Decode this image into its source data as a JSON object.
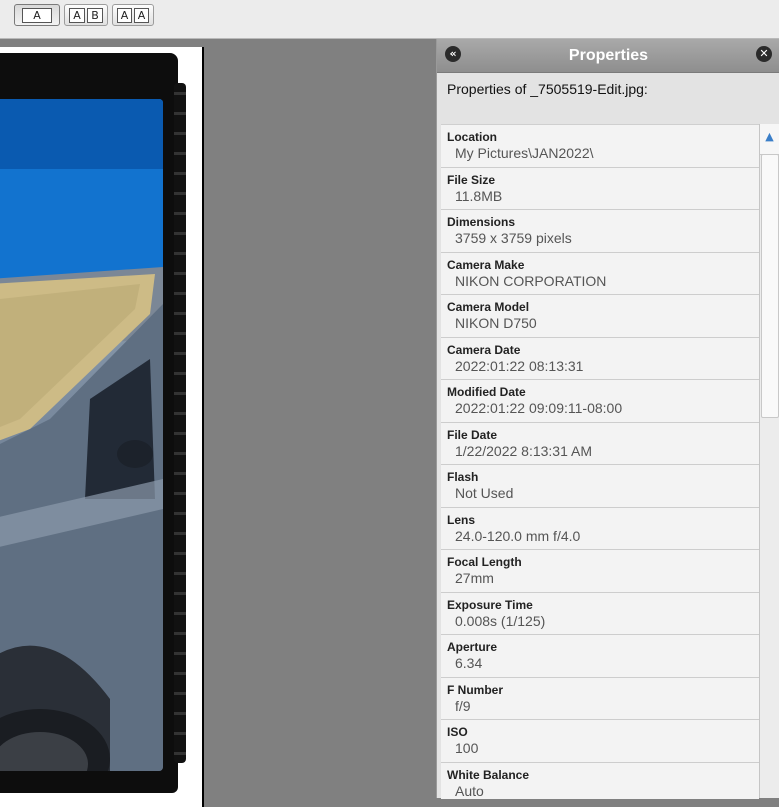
{
  "toolbar": {
    "buttons": [
      {
        "cells": [
          "A"
        ]
      },
      {
        "cells": [
          "A",
          "B"
        ]
      },
      {
        "cells": [
          "A",
          "A"
        ]
      }
    ]
  },
  "panel": {
    "title": "Properties",
    "collapse_icon": "double-chevron-left-icon",
    "close_icon": "close-icon",
    "subtitle": "Properties of _7505519-Edit.jpg:",
    "scroll_up_icon": "chevron-up-icon",
    "items": [
      {
        "label": "Location",
        "value": "My Pictures\\JAN2022\\"
      },
      {
        "label": "File Size",
        "value": "11.8MB"
      },
      {
        "label": "Dimensions",
        "value": "3759 x 3759 pixels"
      },
      {
        "label": "Camera Make",
        "value": "NIKON CORPORATION"
      },
      {
        "label": "Camera Model",
        "value": "NIKON D750"
      },
      {
        "label": "Camera Date",
        "value": "2022:01:22 08:13:31"
      },
      {
        "label": "Modified Date",
        "value": "2022:01:22 09:09:11-08:00"
      },
      {
        "label": "File Date",
        "value": "1/22/2022 8:13:31 AM"
      },
      {
        "label": "Flash",
        "value": "Not Used"
      },
      {
        "label": "Lens",
        "value": "24.0-120.0 mm f/4.0"
      },
      {
        "label": "Focal Length",
        "value": "27mm"
      },
      {
        "label": "Exposure Time",
        "value": "0.008s (1/125)"
      },
      {
        "label": "Aperture",
        "value": "6.34"
      },
      {
        "label": "F Number",
        "value": "f/9"
      },
      {
        "label": "ISO",
        "value": "100"
      },
      {
        "label": "White Balance",
        "value": "Auto"
      }
    ]
  }
}
